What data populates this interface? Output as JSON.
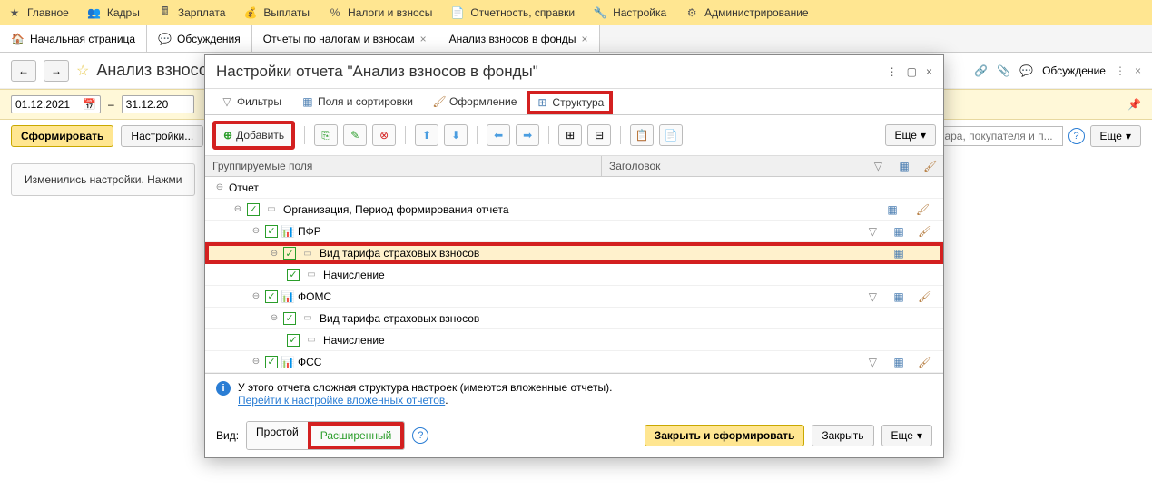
{
  "top_menu": {
    "items": [
      {
        "label": "Главное",
        "icon": "star"
      },
      {
        "label": "Кадры",
        "icon": "people"
      },
      {
        "label": "Зарплата",
        "icon": "calc"
      },
      {
        "label": "Выплаты",
        "icon": "money"
      },
      {
        "label": "Налоги и взносы",
        "icon": "percent"
      },
      {
        "label": "Отчетность, справки",
        "icon": "doc"
      },
      {
        "label": "Настройка",
        "icon": "wrench"
      },
      {
        "label": "Администрирование",
        "icon": "gear"
      }
    ]
  },
  "tabs": {
    "items": [
      {
        "label": "Начальная страница",
        "icon": "home",
        "closable": false
      },
      {
        "label": "Обсуждения",
        "icon": "chat",
        "closable": false
      },
      {
        "label": "Отчеты по налогам и взносам",
        "icon": "",
        "closable": true
      },
      {
        "label": "Анализ взносов в фонды",
        "icon": "",
        "closable": true
      }
    ]
  },
  "page": {
    "title": "Анализ взносо",
    "date_from": "01.12.2021",
    "date_to": "31.12.20",
    "date_sep": "–"
  },
  "toolbar_right": {
    "discuss": "Обсуждение",
    "more": "Еще"
  },
  "actions": {
    "form": "Сформировать",
    "settings": "Настройки...",
    "search_placeholder": "овара, покупателя и п...",
    "more": "Еще"
  },
  "notice": "Изменились настройки. Нажми",
  "modal": {
    "title": "Настройки отчета \"Анализ взносов в фонды\"",
    "tabs": {
      "filters": "Фильтры",
      "fields": "Поля и сортировки",
      "appearance": "Оформление",
      "structure": "Структура"
    },
    "toolbar": {
      "add": "Добавить",
      "more": "Еще"
    },
    "tree": {
      "header_groups": "Группируемые поля",
      "header_title": "Заголовок",
      "rows": [
        {
          "label": "Отчет",
          "indent": 0,
          "chk": false,
          "hl": false,
          "icons": ""
        },
        {
          "label": "Организация, Период формирования отчета",
          "indent": 1,
          "chk": true,
          "hl": false,
          "icons": "cols"
        },
        {
          "label": "ПФР",
          "indent": 2,
          "chk": true,
          "hl": false,
          "icons": "all"
        },
        {
          "label": "Вид тарифа страховых взносов",
          "indent": 3,
          "chk": true,
          "hl": true,
          "icons": "cols"
        },
        {
          "label": "Начисление",
          "indent": 4,
          "chk": true,
          "hl": false,
          "icons": ""
        },
        {
          "label": "ФОМС",
          "indent": 2,
          "chk": true,
          "hl": false,
          "icons": "all"
        },
        {
          "label": "Вид тарифа страховых взносов",
          "indent": 3,
          "chk": true,
          "hl": false,
          "icons": ""
        },
        {
          "label": "Начисление",
          "indent": 4,
          "chk": true,
          "hl": false,
          "icons": ""
        },
        {
          "label": "ФСС",
          "indent": 2,
          "chk": true,
          "hl": false,
          "icons": "all"
        }
      ]
    },
    "info": {
      "text": "У этого отчета сложная структура настроек (имеются вложенные отчеты).",
      "link": "Перейти к настройке вложенных отчетов"
    },
    "footer": {
      "view_label": "Вид:",
      "simple": "Простой",
      "advanced": "Расширенный",
      "close_form": "Закрыть и сформировать",
      "close": "Закрыть",
      "more": "Еще"
    }
  }
}
